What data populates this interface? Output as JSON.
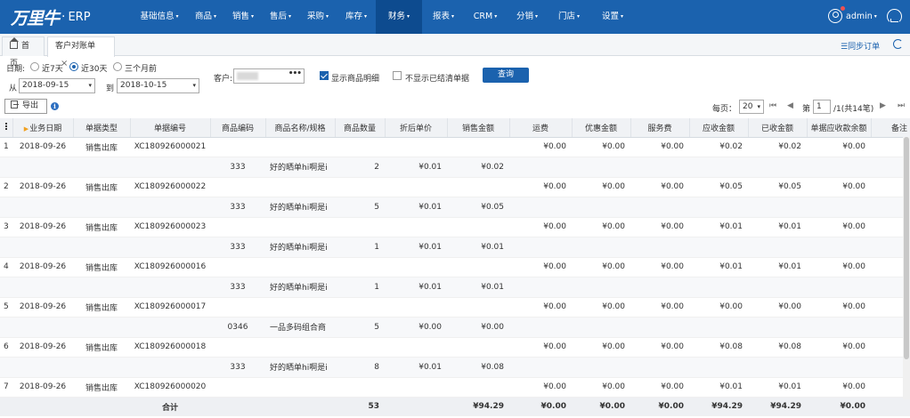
{
  "brand": {
    "logo_text": "万里牛",
    "product": "ERP"
  },
  "nav": {
    "items": [
      {
        "label": "基础信息",
        "caret": "▾"
      },
      {
        "label": "商品",
        "caret": "▾"
      },
      {
        "label": "销售",
        "caret": "▾"
      },
      {
        "label": "售后",
        "caret": "▾"
      },
      {
        "label": "采购",
        "caret": "▾"
      },
      {
        "label": "库存",
        "caret": "▾"
      },
      {
        "label": "财务",
        "caret": "▾",
        "active": true
      },
      {
        "label": "报表",
        "caret": "▾"
      },
      {
        "label": "CRM",
        "caret": "▾"
      },
      {
        "label": "分销",
        "caret": "▾"
      },
      {
        "label": "门店",
        "caret": "▾"
      },
      {
        "label": "设置",
        "caret": "▾"
      }
    ],
    "user": "admin",
    "user_caret": "▾"
  },
  "tabs": {
    "home": "首页",
    "current": "客户对账单",
    "close": "×"
  },
  "sync_link": "☰同步订单",
  "filters": {
    "date_label": "日期:",
    "date_options": [
      "近7天",
      "近30天",
      "三个月前"
    ],
    "date_selected": 1,
    "from_label": "从",
    "from_date": "2018-09-15",
    "to_label": "到",
    "to_date": "2018-10-15",
    "customer_label": "客户:",
    "customer_dots": "•••",
    "show_detail_label": "显示商品明细",
    "show_detail_checked": true,
    "hide_settled_label": "不显示已结清单据",
    "hide_settled_checked": false,
    "query_label": "查询"
  },
  "toolbar": {
    "export_label": "导出",
    "info_glyph": "i"
  },
  "pager": {
    "per_page_label": "每页：",
    "per_page": "20",
    "first": "⏮",
    "prev": "◀",
    "page_prefix": "第",
    "page": "1",
    "page_suffix": "/1(共14笔)",
    "next": "▶",
    "last": "⏭"
  },
  "table": {
    "headers": [
      "业务日期",
      "单据类型",
      "单据编号",
      "商品编码",
      "商品名称/规格",
      "商品数量",
      "折后单价",
      "销售金额",
      "运费",
      "优惠金额",
      "服务费",
      "应收金额",
      "已收金额",
      "单据应收款余额",
      "备注"
    ],
    "sort_mark": "▶",
    "rows": [
      {
        "type": "main",
        "idx": "1",
        "date": "2018-09-26",
        "doc_type": "销售出库",
        "doc_no": "XC180926000021",
        "freight": "¥0.00",
        "discount": "¥0.00",
        "service": "¥0.00",
        "receivable": "¥0.02",
        "received": "¥0.02",
        "balance": "¥0.00"
      },
      {
        "type": "sub",
        "code": "333",
        "name": "好的晒单hi啊是i",
        "qty": "2",
        "price": "¥0.01",
        "amount": "¥0.02"
      },
      {
        "type": "main",
        "idx": "2",
        "date": "2018-09-26",
        "doc_type": "销售出库",
        "doc_no": "XC180926000022",
        "freight": "¥0.00",
        "discount": "¥0.00",
        "service": "¥0.00",
        "receivable": "¥0.05",
        "received": "¥0.05",
        "balance": "¥0.00"
      },
      {
        "type": "sub",
        "code": "333",
        "name": "好的晒单hi啊是i",
        "qty": "5",
        "price": "¥0.01",
        "amount": "¥0.05"
      },
      {
        "type": "main",
        "idx": "3",
        "date": "2018-09-26",
        "doc_type": "销售出库",
        "doc_no": "XC180926000023",
        "freight": "¥0.00",
        "discount": "¥0.00",
        "service": "¥0.00",
        "receivable": "¥0.01",
        "received": "¥0.01",
        "balance": "¥0.00"
      },
      {
        "type": "sub",
        "code": "333",
        "name": "好的晒单hi啊是i",
        "qty": "1",
        "price": "¥0.01",
        "amount": "¥0.01"
      },
      {
        "type": "main",
        "idx": "4",
        "date": "2018-09-26",
        "doc_type": "销售出库",
        "doc_no": "XC180926000016",
        "freight": "¥0.00",
        "discount": "¥0.00",
        "service": "¥0.00",
        "receivable": "¥0.01",
        "received": "¥0.01",
        "balance": "¥0.00"
      },
      {
        "type": "sub",
        "code": "333",
        "name": "好的晒单hi啊是i",
        "qty": "1",
        "price": "¥0.01",
        "amount": "¥0.01"
      },
      {
        "type": "main",
        "idx": "5",
        "date": "2018-09-26",
        "doc_type": "销售出库",
        "doc_no": "XC180926000017",
        "freight": "¥0.00",
        "discount": "¥0.00",
        "service": "¥0.00",
        "receivable": "¥0.00",
        "received": "¥0.00",
        "balance": "¥0.00"
      },
      {
        "type": "sub",
        "code": "0346",
        "name": "一品多码组合商",
        "qty": "5",
        "price": "¥0.00",
        "amount": "¥0.00"
      },
      {
        "type": "main",
        "idx": "6",
        "date": "2018-09-26",
        "doc_type": "销售出库",
        "doc_no": "XC180926000018",
        "freight": "¥0.00",
        "discount": "¥0.00",
        "service": "¥0.00",
        "receivable": "¥0.08",
        "received": "¥0.08",
        "balance": "¥0.00"
      },
      {
        "type": "sub",
        "code": "333",
        "name": "好的晒单hi啊是i",
        "qty": "8",
        "price": "¥0.01",
        "amount": "¥0.08"
      },
      {
        "type": "main",
        "idx": "7",
        "date": "2018-09-26",
        "doc_type": "销售出库",
        "doc_no": "XC180926000020",
        "freight": "¥0.00",
        "discount": "¥0.00",
        "service": "¥0.00",
        "receivable": "¥0.01",
        "received": "¥0.01",
        "balance": "¥0.00"
      }
    ],
    "totals": {
      "label": "合计",
      "qty": "53",
      "amount": "¥94.29",
      "freight": "¥0.00",
      "discount": "¥0.00",
      "service": "¥0.00",
      "receivable": "¥94.29",
      "received": "¥94.29",
      "balance": "¥0.00"
    }
  },
  "colors": {
    "nav_bg": "#1b62ae",
    "nav_active": "#0d4b8f",
    "accent": "#1b62ae"
  }
}
